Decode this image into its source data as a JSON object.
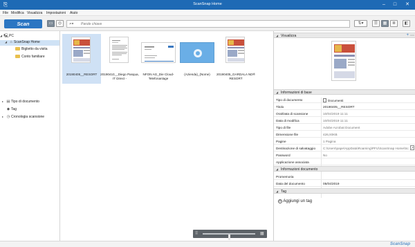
{
  "window": {
    "title": "ScanSnap Home",
    "minimize": "–",
    "maximize": "□",
    "close": "✕"
  },
  "menu": [
    "File",
    "Modifica",
    "Visualizza",
    "Impostazioni",
    "Aiuto"
  ],
  "toolbar": {
    "scan_label": "Scan",
    "search_placeholder": "Parole chiave"
  },
  "tree": {
    "root": "PC",
    "home": "ScanSnap Home",
    "folders": [
      "Biglietto da visita",
      "Conto familiare"
    ],
    "filters": [
      "Tipo di documento",
      "Tag",
      "Cronologia scansione"
    ]
  },
  "thumbnails": [
    {
      "label": "20190405__RESORT",
      "selected": true
    },
    {
      "label": "20190410__Diego Pasqua, IT Direct -",
      "selected": false
    },
    {
      "label": "NFON AG_Die Cloud-Telefonanlage",
      "selected": false
    },
    {
      "label": "(Azienda)_(Nome)",
      "selected": false
    },
    {
      "label": "20190405_GARDALA ND® RESORT",
      "selected": false
    }
  ],
  "zoom": {
    "level": 0.5
  },
  "right_panel": {
    "preview_header": "Visualizza",
    "info_header": "Informazioni di base",
    "basic_info": [
      {
        "key": "Tipo di documento",
        "value": "Documenti"
      },
      {
        "key": "Titolo",
        "value": "20190405__RESORT"
      },
      {
        "key": "Ora/Data di scansione",
        "value": "10/04/2019 11:11"
      },
      {
        "key": "Data di modifica",
        "value": "10/04/2019 11:11"
      },
      {
        "key": "Tipo di file",
        "value": "Adobe Acrobat Document"
      },
      {
        "key": "Dimensione file",
        "value": "426,93KB"
      },
      {
        "key": "Pagine",
        "value": "1 Pagina"
      },
      {
        "key": "Destinazione di salvataggio",
        "value": "C:\\Users\\pape\\AppData\\Roaming\\PFU\\ScanSnap Home\\ScanSnap Home"
      },
      {
        "key": "Password",
        "value": "No"
      },
      {
        "key": "Applicazione associata",
        "value": ""
      }
    ],
    "doc_info_header": "Informazioni documento",
    "doc_info": [
      {
        "key": "Promemoria",
        "value": ""
      },
      {
        "key": "Data del documento",
        "value": "05/04/2019"
      }
    ],
    "tag_header": "Tag",
    "add_tag": "Aggiungi un tag"
  },
  "status": {
    "brand": "ScanSnap"
  },
  "colors": {
    "accent": "#2b76c2",
    "titlebar": "#1e6ab5",
    "selection": "#cfe1f5"
  }
}
